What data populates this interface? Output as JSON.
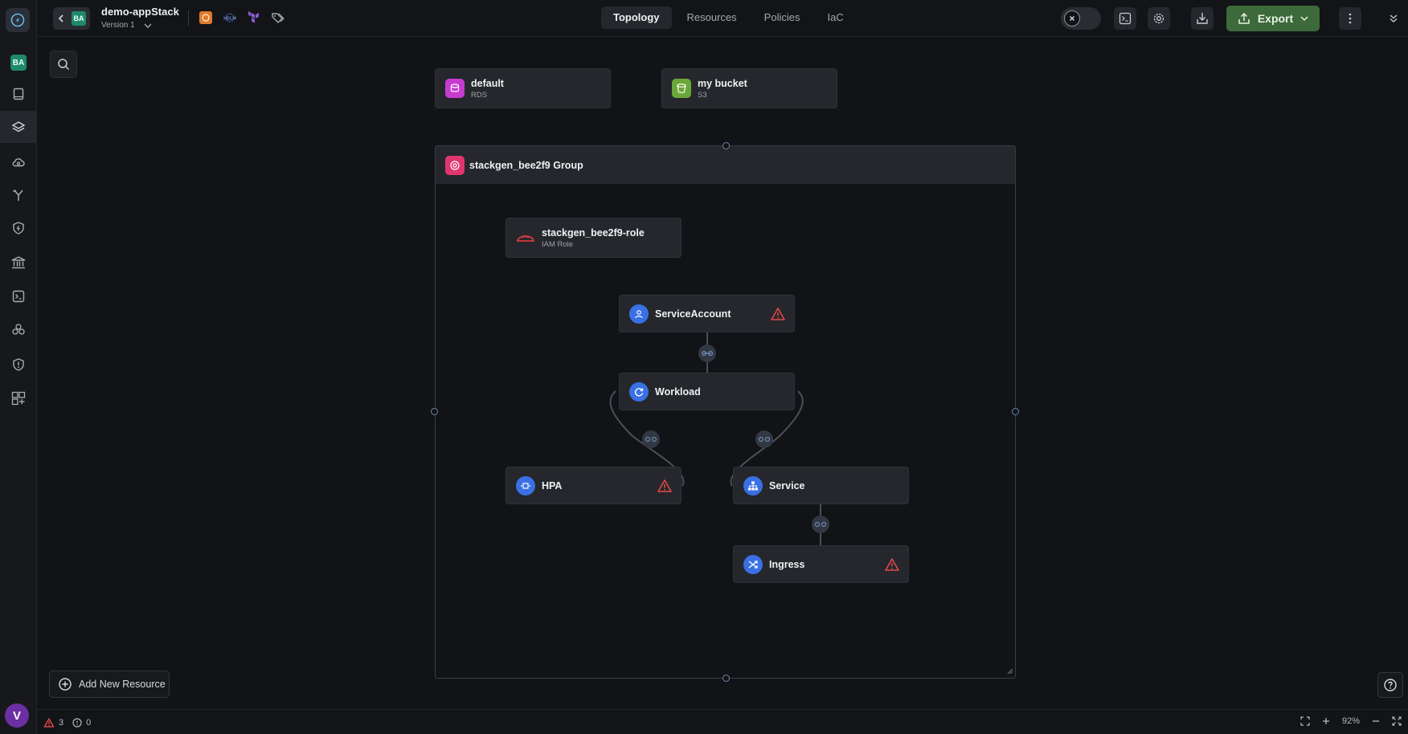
{
  "rail": {
    "workspace_badge": "BA",
    "avatar_initial": "V"
  },
  "header": {
    "back_badge": "BA",
    "app_name": "demo-appStack",
    "version_label": "Version 1"
  },
  "tabs": [
    {
      "label": "Topology",
      "active": true
    },
    {
      "label": "Resources",
      "active": false
    },
    {
      "label": "Policies",
      "active": false
    },
    {
      "label": "IaC",
      "active": false
    }
  ],
  "toolbar": {
    "export_label": "Export"
  },
  "nodes": {
    "rds": {
      "title": "default",
      "subtitle": "RDS",
      "icon": "rds-icon",
      "color": "#c83bd0"
    },
    "s3": {
      "title": "my bucket",
      "subtitle": "S3",
      "icon": "s3-bucket-icon",
      "color": "#6aa739"
    },
    "group": {
      "title": "stackgen_bee2f9 Group",
      "icon": "group-icon",
      "color": "#e0356f"
    },
    "role": {
      "title": "stackgen_bee2f9-role",
      "subtitle": "IAM Role",
      "icon": "iam-role-icon",
      "color": "#d53b3b"
    },
    "service_account": {
      "title": "ServiceAccount",
      "icon": "kubernetes-icon",
      "warning": true
    },
    "workload": {
      "title": "Workload",
      "icon": "kubernetes-icon",
      "warning": false
    },
    "hpa": {
      "title": "HPA",
      "icon": "kubernetes-icon",
      "warning": true
    },
    "service": {
      "title": "Service",
      "icon": "kubernetes-icon",
      "warning": false
    },
    "ingress": {
      "title": "Ingress",
      "icon": "kubernetes-icon",
      "warning": true
    }
  },
  "canvas": {
    "add_resource_label": "Add New Resource"
  },
  "statusbar": {
    "warnings_count": "3",
    "info_count": "0",
    "zoom_level": "92%"
  },
  "colors": {
    "k8s_blue": "#3970e4",
    "warning_red": "#e2484b",
    "export_green": "#3c6a3a",
    "edge_link": "#3a4a66"
  }
}
